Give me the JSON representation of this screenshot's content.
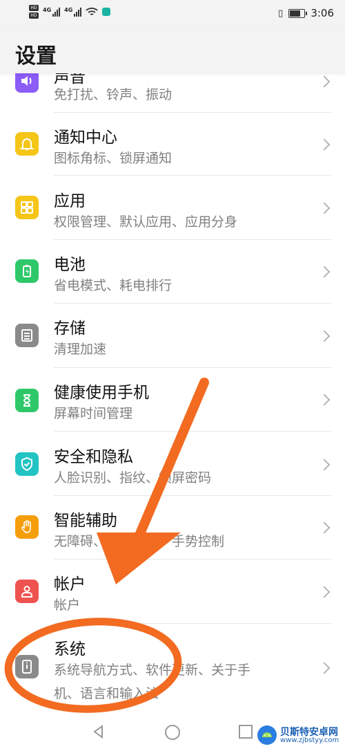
{
  "status_bar": {
    "hd1": "HD",
    "hd2": "HD",
    "gen1": "4G",
    "gen2": "4G",
    "time": "3:06"
  },
  "header": {
    "title": "设置"
  },
  "items": [
    {
      "title": "声音",
      "subtitle": "免打扰、铃声、振动",
      "subtitle2": "",
      "icon": "speaker-icon",
      "color": "#8b5cf6"
    },
    {
      "title": "通知中心",
      "subtitle": "图标角标、锁屏通知",
      "subtitle2": "",
      "icon": "bell-icon",
      "color": "#f5c518"
    },
    {
      "title": "应用",
      "subtitle": "权限管理、默认应用、应用分身",
      "subtitle2": "",
      "icon": "apps-grid-icon",
      "color": "#f5c518"
    },
    {
      "title": "电池",
      "subtitle": "省电模式、耗电排行",
      "subtitle2": "",
      "icon": "battery-icon",
      "color": "#2ec86a"
    },
    {
      "title": "存储",
      "subtitle": "清理加速",
      "subtitle2": "",
      "icon": "storage-icon",
      "color": "#8a8a8a"
    },
    {
      "title": "健康使用手机",
      "subtitle": "屏幕时间管理",
      "subtitle2": "",
      "icon": "hourglass-icon",
      "color": "#2ec86a"
    },
    {
      "title": "安全和隐私",
      "subtitle": "人脸识别、指纹、锁屏密码",
      "subtitle2": "",
      "icon": "shield-icon",
      "color": "#22c3c3"
    },
    {
      "title": "智能辅助",
      "subtitle": "无障碍、智能识屏、手势控制",
      "subtitle2": "",
      "icon": "hand-icon",
      "color": "#f59e0b"
    },
    {
      "title": "帐户",
      "subtitle": "帐户",
      "subtitle2": "",
      "icon": "person-icon",
      "color": "#ef5350"
    },
    {
      "title": "系统",
      "subtitle": "系统导航方式、软件更新、关于手",
      "subtitle2": "机、语言和输入法",
      "icon": "system-icon",
      "color": "#8a8a8a"
    }
  ],
  "annotation_color": "#f26b21",
  "watermark": {
    "title": "贝斯特安卓网",
    "url": "www.zjbstyy.com"
  }
}
